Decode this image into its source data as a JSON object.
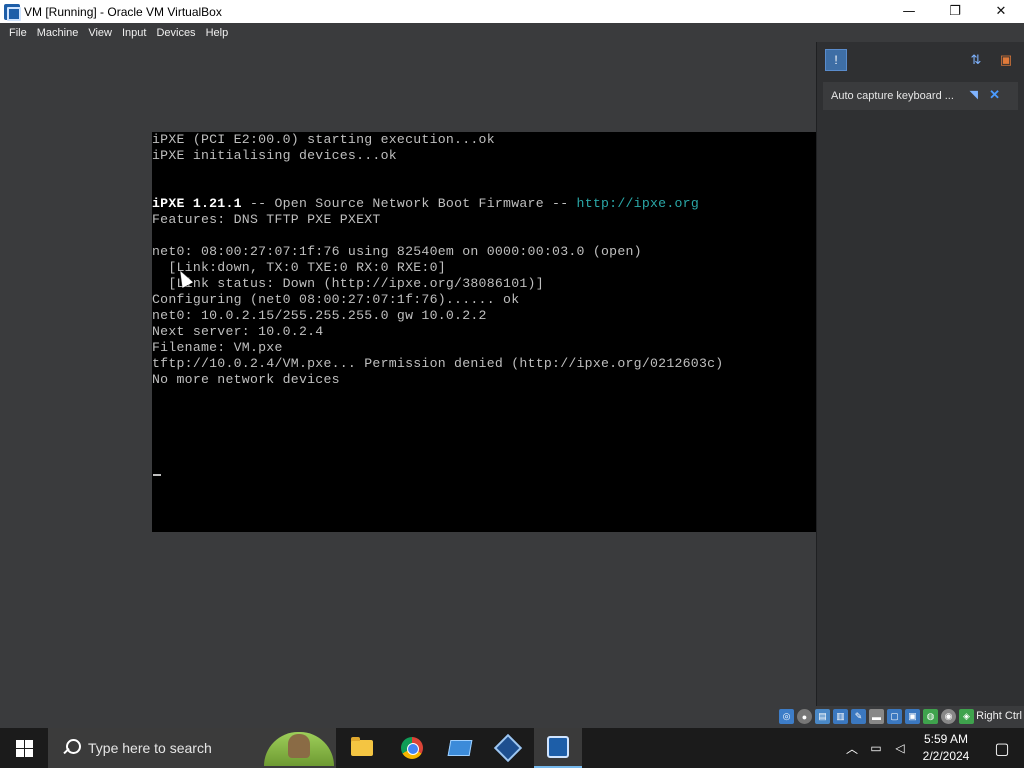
{
  "window": {
    "title": "VM [Running] - Oracle VM VirtualBox",
    "minimize_glyph": "—",
    "maximize_glyph": "❐",
    "close_glyph": "✕"
  },
  "menu": [
    "File",
    "Machine",
    "View",
    "Input",
    "Devices",
    "Help"
  ],
  "terminal": {
    "lines": [
      "iPXE (PCI E2:00.0) starting execution...ok",
      "iPXE initialising devices...ok",
      "",
      "",
      "",
      "Features: DNS TFTP PXE PXEXT",
      "",
      "net0: 08:00:27:07:1f:76 using 82540em on 0000:00:03.0 (open)",
      "  [Link:down, TX:0 TXE:0 RX:0 RXE:0]",
      "  [Link status: Down (http://ipxe.org/38086101)]",
      "Configuring (net0 08:00:27:07:1f:76)...... ok",
      "net0: 10.0.2.15/255.255.255.0 gw 10.0.2.2",
      "Next server: 10.0.2.4",
      "Filename: VM.pxe",
      "tftp://10.0.2.4/VM.pxe... Permission denied (http://ipxe.org/0212603c)",
      "No more network devices"
    ],
    "banner_bright": "iPXE 1.21.1",
    "banner_mid": " -- Open Source Network Boot Firmware -- ",
    "banner_link": "http://ipxe.org"
  },
  "side_panel": {
    "notification_text": "Auto capture keyboard ...",
    "message_icon": "message-icon",
    "sort_icon": "sort-icon",
    "settings_icon": "settings-icon"
  },
  "statusbar": {
    "host_key": "Right Ctrl"
  },
  "taskbar": {
    "search_placeholder": "Type here to search",
    "time": "5:59 AM",
    "date": "2/2/2024"
  },
  "colors": {
    "terminal_text": "#bfbfbf",
    "terminal_link": "#2aa7a7",
    "accent": "#76b9ed"
  }
}
